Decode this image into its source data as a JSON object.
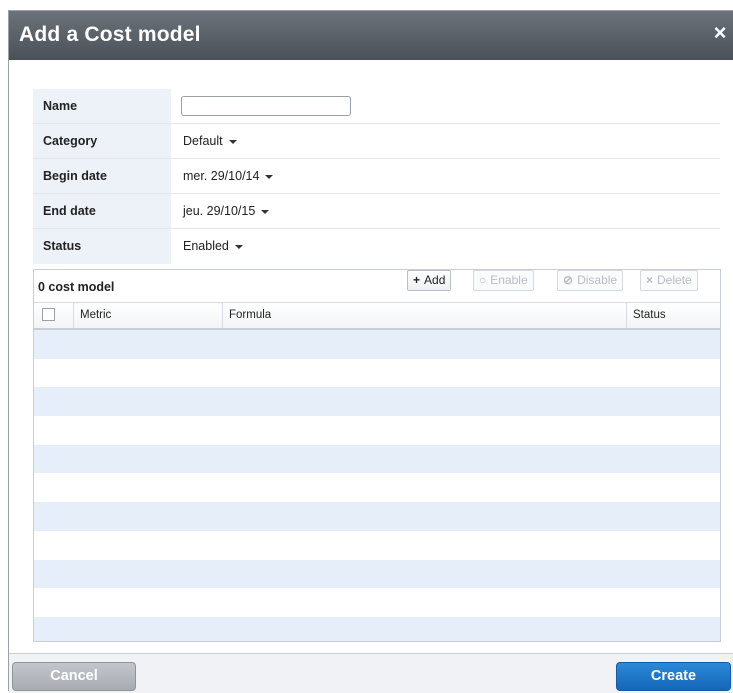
{
  "dialog": {
    "title": "Add a Cost model",
    "close_symbol": "×"
  },
  "form": {
    "name_label": "Name",
    "name_value": "",
    "category_label": "Category",
    "category_value": "Default",
    "begin_label": "Begin date",
    "begin_value": "mer. 29/10/14",
    "end_label": "End date",
    "end_value": "jeu. 29/10/15",
    "status_label": "Status",
    "status_value": "Enabled"
  },
  "grid": {
    "count_text": "0 cost model",
    "add_icon": "+",
    "add_label": "Add",
    "enable_icon": "○",
    "enable_label": "Enable",
    "disable_icon": "⊘",
    "disable_label": "Disable",
    "delete_icon": "×",
    "delete_label": "Delete",
    "columns": [
      "Metric",
      "Formula",
      "Status"
    ],
    "empty_stripes": 11
  },
  "footer": {
    "cancel_label": "Cancel",
    "create_label": "Create"
  },
  "colors": {
    "title_bar": "#5a6168",
    "label_bg": "#edf1f8",
    "stripe": "#e6eef9",
    "create_button": "#1f7ad0"
  }
}
